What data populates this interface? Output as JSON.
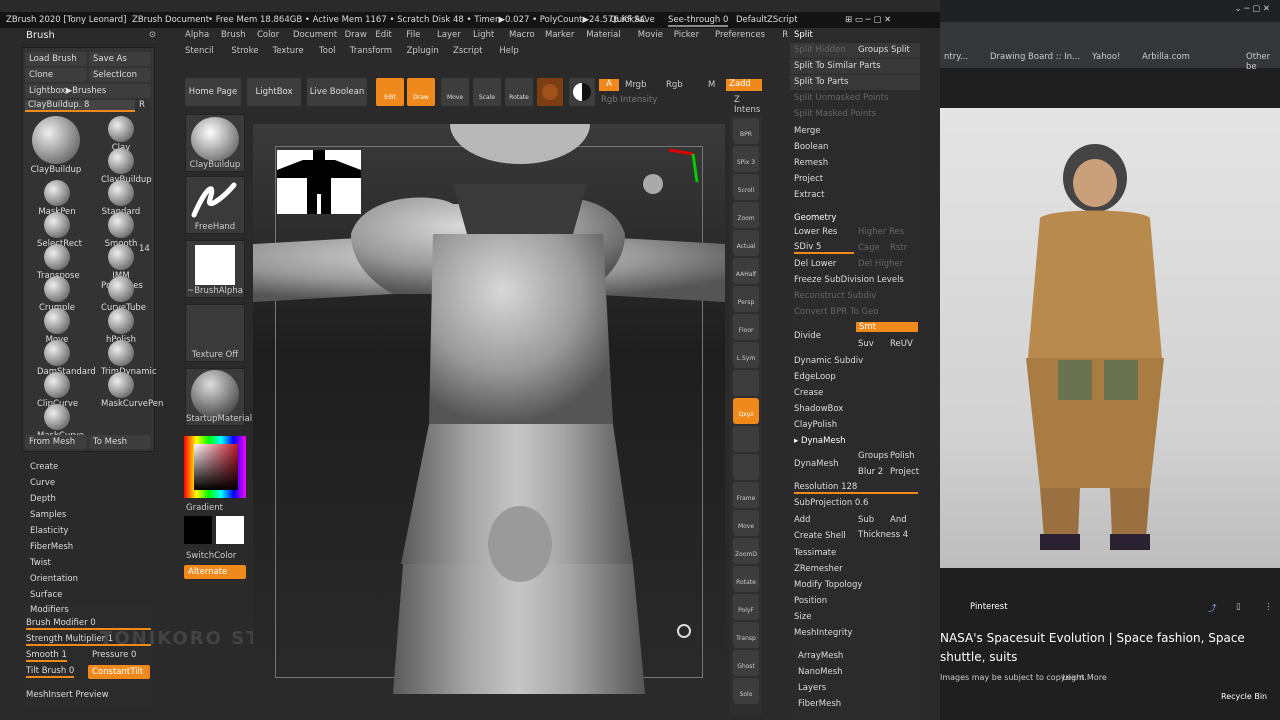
{
  "title": {
    "app": "ZBrush 2020 [Tony Leonard]",
    "doc": "ZBrush Document",
    "mem": "• Free Mem 18.864GB • Active Mem 1167 • Scratch Disk 48 • Timer▶0.027 • PolyCount▶24.576 KF  AC",
    "quicksave": "QuickSave",
    "seethrough": "See-through  0",
    "script": "DefaultZScript"
  },
  "menu1": [
    "Alpha",
    "Brush",
    "Color",
    "Document",
    "Draw",
    "Edit",
    "File",
    "Layer",
    "Light",
    "Macro",
    "Marker",
    "Material",
    "Movie",
    "Picker",
    "Preferences",
    "Render"
  ],
  "menu2": [
    "Stencil",
    "Stroke",
    "Texture",
    "Tool",
    "Transform",
    "Zplugin",
    "Zscript",
    "Help"
  ],
  "brushpanel": {
    "title": "Brush",
    "load": "Load Brush",
    "saveas": "Save As",
    "clone": "Clone",
    "selecticon": "SelectIcon",
    "lightbox": "Lightbox▶Brushes",
    "current": "ClayBuildup. 8",
    "r": "R",
    "count": "14",
    "brushes": [
      "ClayBuildup",
      "Clay",
      "ClayBuildup",
      "MaskPen",
      "Standard",
      "SelectRect",
      "Smooth",
      "Transpose",
      "IMM Primitives",
      "Crumple",
      "CurveTube",
      "Move",
      "hPolish",
      "DamStandard",
      "TrimDynamic",
      "ClipCurve",
      "MaskCurvePen",
      "MaskCurve"
    ],
    "frommesh": "From Mesh",
    "tomesh": "To Mesh"
  },
  "brushmenu": [
    "Create",
    "Curve",
    "Depth",
    "Samples",
    "Elasticity",
    "FiberMesh",
    "Twist",
    "Orientation",
    "Surface"
  ],
  "modifiers": {
    "title": "Modifiers",
    "brushmod": "Brush Modifier 0",
    "strength": "Strength Multiplier 1",
    "smooth": "Smooth 1",
    "pressure": "Pressure 0",
    "tilt": "Tilt Brush 0",
    "constant": "ConstantTilt",
    "meshinsert": "MeshInsert Preview"
  },
  "toolcol": {
    "brush": "ClayBuildup",
    "stroke": "FreeHand",
    "alpha": "~BrushAlpha",
    "texture": "Texture Off",
    "material": "StartupMaterial",
    "gradient": "Gradient",
    "switch": "SwitchColor",
    "alternate": "Alternate"
  },
  "toolbar": {
    "home": "Home Page",
    "lightbox": "LightBox",
    "live": "Live Boolean",
    "edit": "Edit",
    "draw": "Draw",
    "move": "Move",
    "scale": "Scale",
    "rotate": "Rotate",
    "a": "A",
    "mrgb": "Mrgb",
    "rgb": "Rgb",
    "m": "M",
    "zadd": "Zadd",
    "zint": "Z Intens",
    "rgbint": "Rgb Intensity"
  },
  "shelf": [
    "BPR",
    "SPix 3",
    "Scroll",
    "Zoom",
    "Actual",
    "AAHalf",
    "Persp",
    "Floor",
    "L.Sym",
    "",
    "Qxyz",
    "",
    "",
    "Frame",
    "Move",
    "ZoomD",
    "Rotate",
    "PolyF",
    "Transp",
    "Ghost",
    "Solo"
  ],
  "subtool": {
    "split": "Split",
    "splithidden": "Split Hidden",
    "groupssplit": "Groups Split",
    "similar": "Split To Similar Parts",
    "parts": "Split To Parts",
    "unmasked": "Split Unmasked Points",
    "masked": "Split Masked Points",
    "merge": "Merge",
    "boolean": "Boolean",
    "remesh": "Remesh",
    "project": "Project",
    "extract": "Extract"
  },
  "geometry": {
    "title": "Geometry",
    "lower": "Lower Res",
    "higher": "Higher Res",
    "sdiv": "SDiv 5",
    "cage": "Cage",
    "rstr": "Rstr",
    "dellower": "Del Lower",
    "delhigher": "Del Higher",
    "freeze": "Freeze SubDivision Levels",
    "reconstruct": "Reconstruct Subdiv",
    "convert": "Convert BPR To Geo",
    "divide": "Divide",
    "smt": "Smt",
    "suv": "Suv",
    "reuv": "ReUV",
    "dynsub": "Dynamic Subdiv",
    "edgeloop": "EdgeLoop",
    "crease": "Crease",
    "shadowbox": "ShadowBox",
    "claypolish": "ClayPolish",
    "dynamesh": "▸ DynaMesh",
    "dynameshbtn": "DynaMesh",
    "groups": "Groups",
    "polish": "Polish",
    "blur": "Blur 2",
    "projectb": "Project",
    "resolution": "Resolution 128",
    "subproj": "SubProjection 0.6",
    "add": "Add",
    "sub": "Sub",
    "and": "And",
    "shell": "Create Shell",
    "thickness": "Thickness 4",
    "tess": "Tessimate",
    "zremesh": "ZRemesher",
    "modtopo": "Modify Topology",
    "position": "Position",
    "size": "Size",
    "meshint": "MeshIntegrity",
    "arraymesh": "ArrayMesh",
    "nanomesh": "NanoMesh",
    "layers": "Layers",
    "fibermesh": "FiberMesh"
  },
  "browser": {
    "bm1": "Drawing Board :: In...",
    "bm2": "Yahoo!",
    "bm3": "Arbilla.com",
    "bm4": "Other be",
    "source": "Pinterest",
    "caption": "NASA's Spacesuit Evolution | Space fashion, Space shuttle, suits",
    "copyright": "Images may be subject to copyright.",
    "learn": "Learn More",
    "recycle": "Recycle Bin"
  },
  "watermark": "TONIKORO STUDIOS"
}
